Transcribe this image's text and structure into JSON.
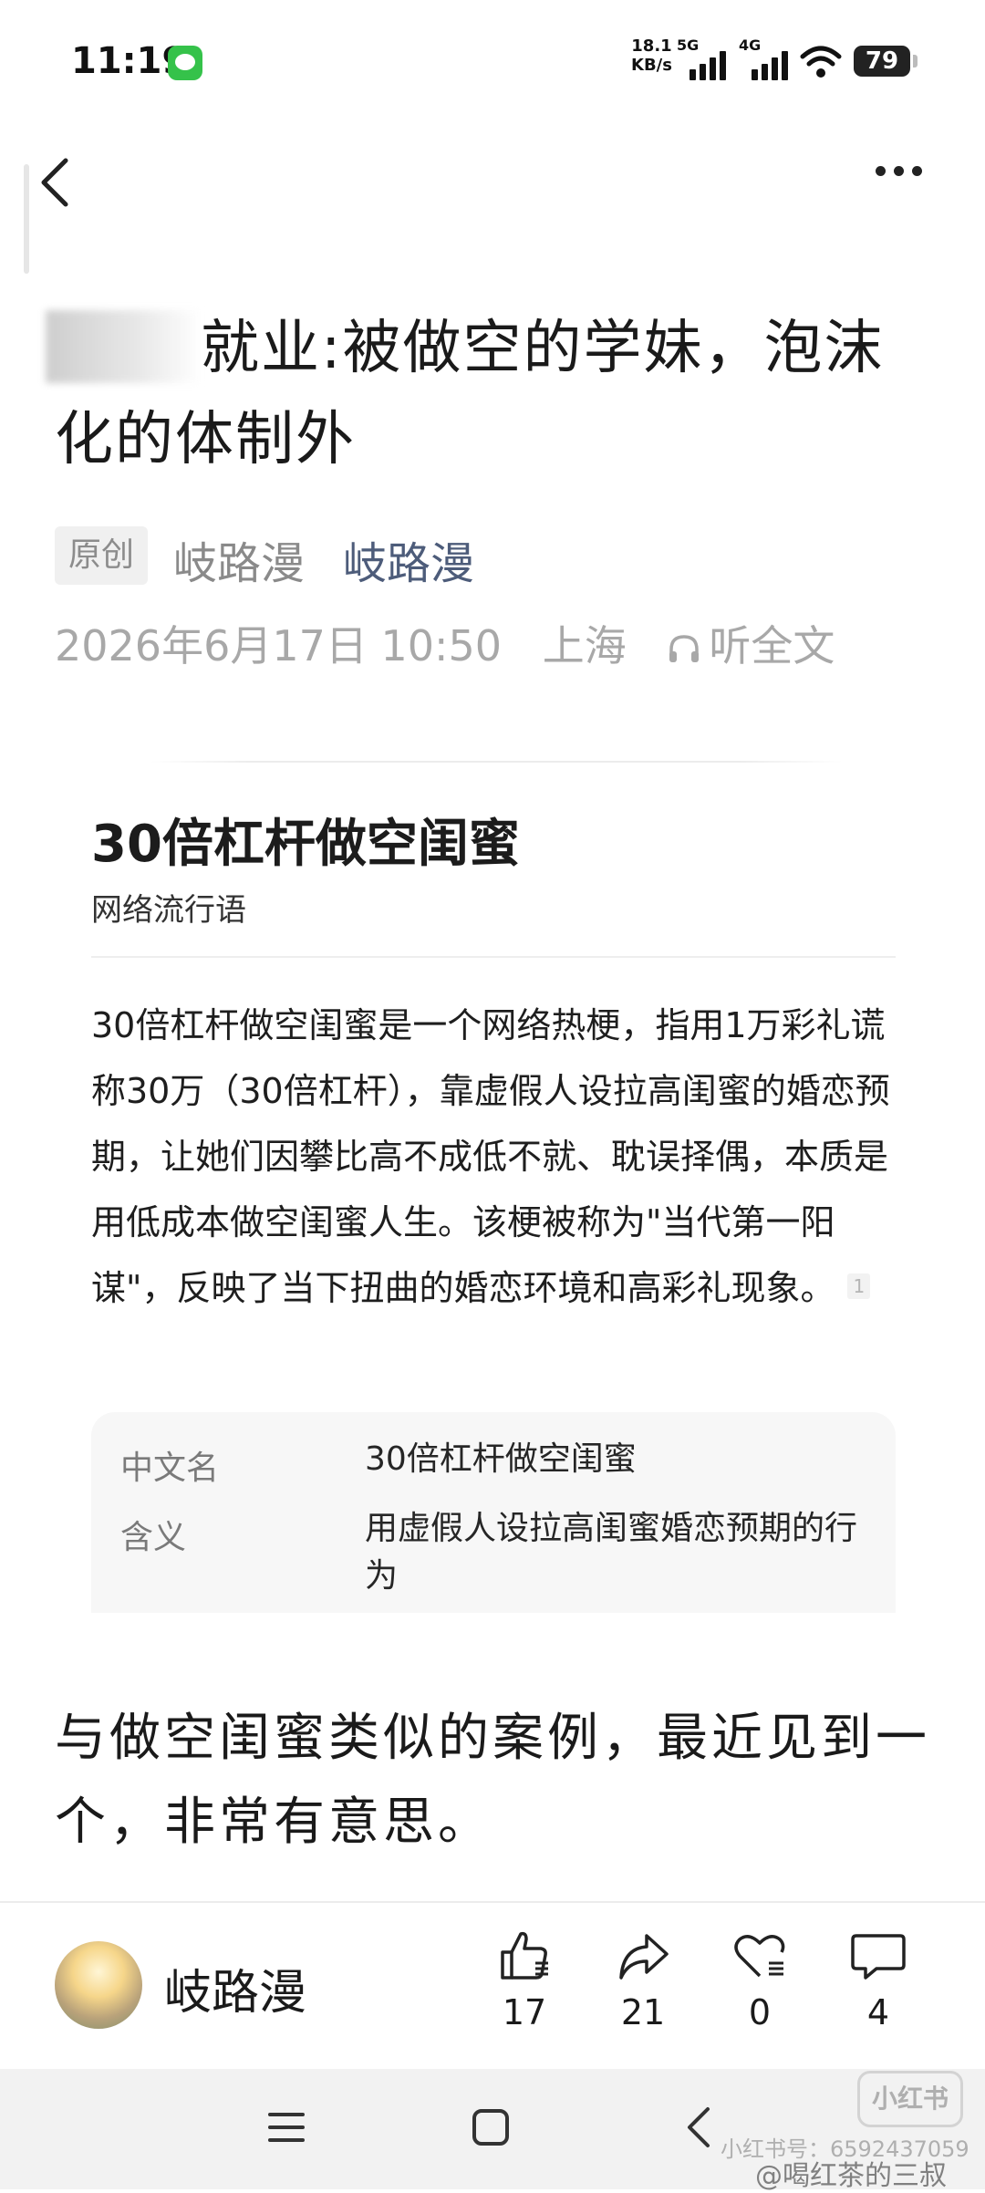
{
  "status_bar": {
    "time": "11:19",
    "net_speed_value": "18.1",
    "net_speed_unit": "KB/s",
    "network_1": "5G",
    "network_2": "4G",
    "battery": "79"
  },
  "header": {
    "back_icon": "chevron-left-icon",
    "more_icon": "more-horizontal-icon"
  },
  "article": {
    "title": "就业:被做空的学妹，泡沫化的体制外",
    "original_tag": "原创",
    "author_grey": "岐路漫",
    "author_link": "岐路漫",
    "date": "2026年6月17日 10:50",
    "location": "上海",
    "listen_label": "听全文"
  },
  "baike_card": {
    "title": "30倍杠杆做空闺蜜",
    "subtitle": "网络流行语",
    "description": "30倍杠杆做空闺蜜是一个网络热梗，指用1万彩礼谎称30万（30倍杠杆），靠虚假人设拉高闺蜜的婚恋预期，让她们因攀比高不成低不就、耽误择偶，本质是用低成本做空闺蜜人生。该梗被称为\"当代第一阳谋\"，反映了当下扭曲的婚恋环境和高彩礼现象。",
    "reference": "1",
    "info": [
      {
        "key": "中文名",
        "value": "30倍杠杆做空闺蜜"
      },
      {
        "key": "含义",
        "value": "用虚假人设拉高闺蜜婚恋预期的行为"
      }
    ]
  },
  "body": {
    "paragraph": "与做空闺蜜类似的案例，最近见到一个，非常有意思。"
  },
  "action_bar": {
    "author": "岐路漫",
    "like_count": "17",
    "share_count": "21",
    "favorite_count": "0",
    "comment_count": "4"
  },
  "watermark": {
    "logo": "小红书",
    "id_text": "小红书号：6592437059",
    "weibo": "@喝红茶的三叔"
  },
  "colors": {
    "link": "#4d5c7a",
    "meta": "#a8a8a8",
    "infobox_bg": "#f7f7f7",
    "nav_bg": "#f2f2f2"
  }
}
